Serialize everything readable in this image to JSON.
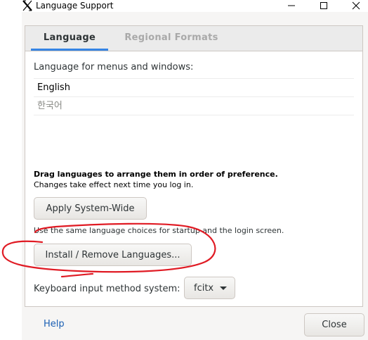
{
  "window": {
    "title": "Language Support"
  },
  "tabs": [
    {
      "label": "Language"
    },
    {
      "label": "Regional Formats"
    }
  ],
  "language_tab": {
    "menus_label": "Language for menus and windows:",
    "languages": [
      "English",
      "한국어"
    ],
    "drag_hint": "Drag languages to arrange them in order of preference.",
    "effect_note": "Changes take effect next time you log in.",
    "apply_button": "Apply System-Wide",
    "startup_note": "Use the same language choices for startup and the login screen.",
    "install_button": "Install / Remove Languages...",
    "keyboard_label": "Keyboard input method system:",
    "keyboard_value": "fcitx"
  },
  "footer": {
    "help": "Help",
    "close": "Close"
  },
  "annotation": {
    "color": "#e01b24"
  }
}
